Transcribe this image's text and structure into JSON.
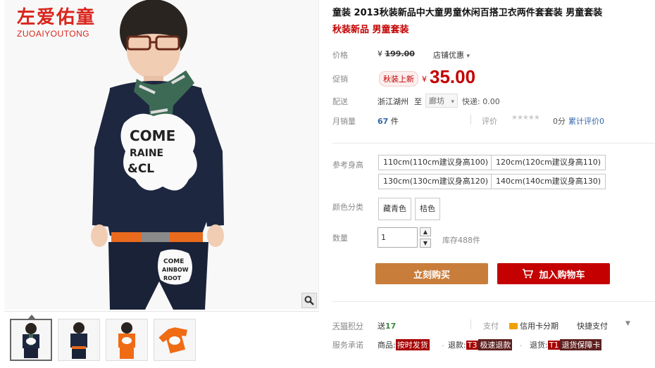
{
  "brand": {
    "name_cn": "左爱佑童",
    "name_en": "ZUOAIYOUTONG"
  },
  "gallery": {
    "thumbnails": [
      "thumb-1",
      "thumb-2",
      "thumb-3",
      "thumb-4"
    ],
    "shirt_text_1": "COME RAINBOW &CLOUD",
    "pants_text": "COME RAINBOW ROOT"
  },
  "product": {
    "title": "童装 2013秋装新品中大童男童休闲百搭卫衣两件套套装 男童套装",
    "subtitle": "秋装新品 男童套装"
  },
  "price": {
    "label": "价格",
    "yen": "¥",
    "original": "199.00",
    "shop_discount": "店铺优惠"
  },
  "promo": {
    "label": "促销",
    "tag": "秋装上新",
    "yen": "¥",
    "price": "35.00"
  },
  "delivery": {
    "label": "配送",
    "from": "浙江湖州",
    "to_label": "至",
    "to": "廊坊",
    "express": "快递: 0.00"
  },
  "sales": {
    "label": "月销量",
    "count": "67",
    "unit": "件",
    "review_label": "评价",
    "stars": "★★★★★",
    "score": "0分",
    "total_reviews": "累计评价0"
  },
  "sizes": {
    "label": "参考身高",
    "options": [
      "110cm(110cm建议身高100)",
      "120cm(120cm建议身高110)",
      "130cm(130cm建议身高120)",
      "140cm(140cm建议身高130)"
    ]
  },
  "colors": {
    "label": "颜色分类",
    "options": [
      "藏青色",
      "桔色"
    ]
  },
  "quantity": {
    "label": "数量",
    "value": "1",
    "stock": "库存488件"
  },
  "buttons": {
    "buy_now": "立刻购买",
    "add_cart": "加入购物车"
  },
  "footer": {
    "points_label": "天猫积分",
    "points_prefix": "送",
    "points_value": "17",
    "pay_label": "支付",
    "credit": "信用卡分期",
    "fast_pay": "快捷支付",
    "service_label": "服务承诺",
    "goods_label": "商品:",
    "goods_badge": "按时发货",
    "refund_label": "退款:",
    "refund_t": "T3",
    "refund_badge": "极速退款",
    "return_label": "退货:",
    "return_t": "T1",
    "return_badge": "退货保障卡"
  },
  "colors_theme": {
    "red": "#c40000",
    "orange": "#c97d3b"
  }
}
